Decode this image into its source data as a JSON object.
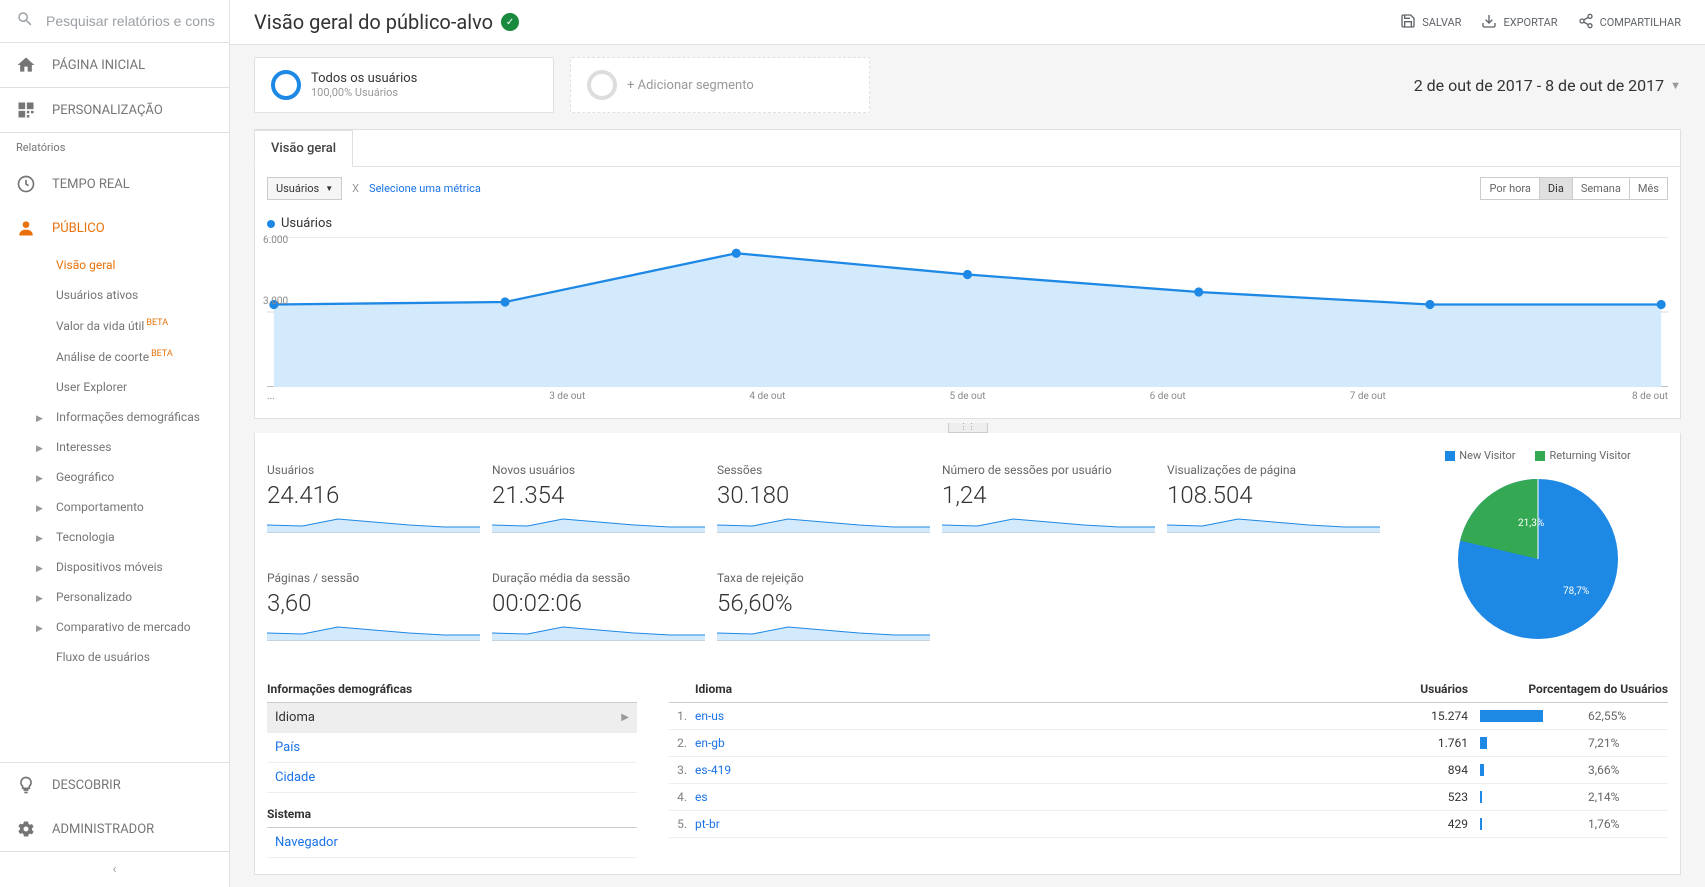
{
  "search": {
    "placeholder": "Pesquisar relatórios e cons"
  },
  "nav": {
    "home": "PÁGINA INICIAL",
    "custom": "PERSONALIZAÇÃO",
    "reports_label": "Relatórios",
    "realtime": "TEMPO REAL",
    "audience": "PÚBLICO",
    "discover": "DESCOBRIR",
    "admin": "ADMINISTRADOR"
  },
  "audience_sub": {
    "overview": "Visão geral",
    "active": "Usuários ativos",
    "ltv": "Valor da vida útil",
    "cohort": "Análise de coorte",
    "explorer": "User Explorer",
    "demographics": "Informações demográficas",
    "interests": "Interesses",
    "geo": "Geográfico",
    "behavior": "Comportamento",
    "technology": "Tecnologia",
    "mobile": "Dispositivos móveis",
    "custom": "Personalizado",
    "benchmarking": "Comparativo de mercado",
    "flow": "Fluxo de usuários",
    "beta": "BETA"
  },
  "page_title": "Visão geral do público-alvo",
  "actions": {
    "save": "SALVAR",
    "export": "EXPORTAR",
    "share": "COMPARTILHAR"
  },
  "segments": {
    "all_users": "Todos os usuários",
    "all_users_sub": "100,00% Usuários",
    "add": "+ Adicionar segmento"
  },
  "date_range": "2 de out de 2017 - 8 de out de 2017",
  "tab_overview": "Visão geral",
  "metric_dropdown": "Usuários",
  "vs_label": "Selecione uma métrica",
  "time": {
    "hour": "Por hora",
    "day": "Dia",
    "week": "Semana",
    "month": "Mês"
  },
  "chart_legend": "Usuários",
  "chart_data": {
    "type": "line",
    "categories": [
      "...",
      "3 de out",
      "4 de out",
      "5 de out",
      "6 de out",
      "7 de out",
      "8 de out"
    ],
    "values": [
      3300,
      3400,
      5350,
      4500,
      3800,
      3300,
      3300
    ],
    "ylabel": "Usuários",
    "ylim": [
      0,
      6000
    ],
    "yticks": [
      "3.000",
      "6.000"
    ]
  },
  "metrics": [
    {
      "label": "Usuários",
      "value": "24.416"
    },
    {
      "label": "Novos usuários",
      "value": "21.354"
    },
    {
      "label": "Sessões",
      "value": "30.180"
    },
    {
      "label": "Número de sessões por usuário",
      "value": "1,24"
    },
    {
      "label": "Visualizações de página",
      "value": "108.504"
    },
    {
      "label": "Páginas / sessão",
      "value": "3,60"
    },
    {
      "label": "Duração média da sessão",
      "value": "00:02:06"
    },
    {
      "label": "Taxa de rejeição",
      "value": "56,60%"
    }
  ],
  "pie": {
    "legend_new": "New Visitor",
    "legend_returning": "Returning Visitor",
    "new_pct": "78,7%",
    "returning_pct": "21,3%",
    "series": [
      {
        "name": "New Visitor",
        "value": 78.7,
        "color": "#1e88e5"
      },
      {
        "name": "Returning Visitor",
        "value": 21.3,
        "color": "#34a853"
      }
    ]
  },
  "dim": {
    "header_demo": "Informações demográficas",
    "language": "Idioma",
    "country": "País",
    "city": "Cidade",
    "header_system": "Sistema",
    "browser": "Navegador"
  },
  "table": {
    "head_dim": "Idioma",
    "head_users": "Usuários",
    "head_pct": "Porcentagem do Usuários",
    "rows": [
      {
        "n": "1.",
        "name": "en-us",
        "users": "15.274",
        "pct": "62,55%",
        "w": 62.55
      },
      {
        "n": "2.",
        "name": "en-gb",
        "users": "1.761",
        "pct": "7,21%",
        "w": 7.21
      },
      {
        "n": "3.",
        "name": "es-419",
        "users": "894",
        "pct": "3,66%",
        "w": 3.66
      },
      {
        "n": "4.",
        "name": "es",
        "users": "523",
        "pct": "2,14%",
        "w": 2.14
      },
      {
        "n": "5.",
        "name": "pt-br",
        "users": "429",
        "pct": "1,76%",
        "w": 1.76
      }
    ]
  }
}
